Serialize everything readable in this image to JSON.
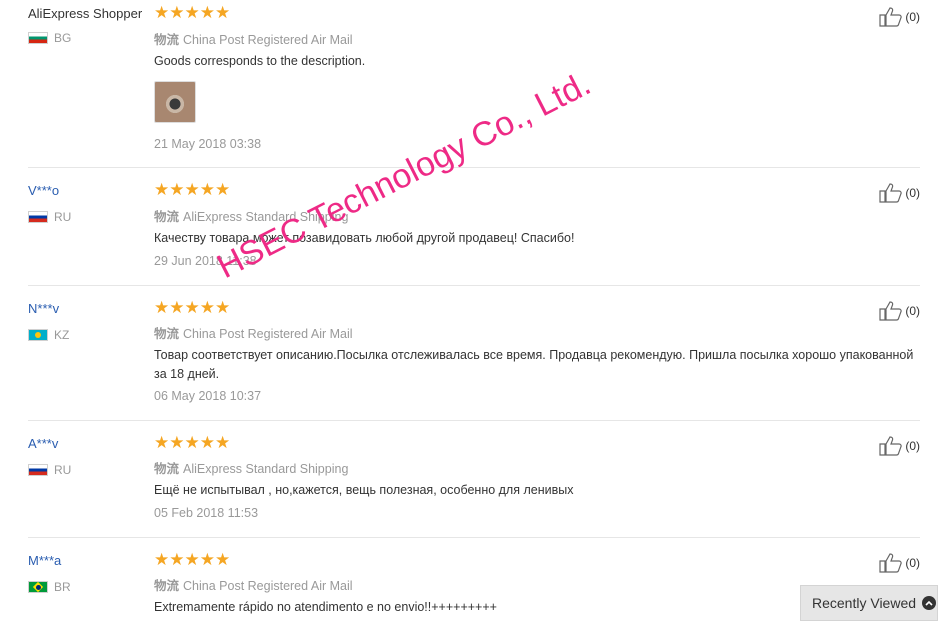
{
  "shipping_tag": "物流",
  "helpful_count": "(0)",
  "reviews": [
    {
      "user": "AliExpress Shopper",
      "country": "BG",
      "rating": 5,
      "stars": "★★★★★",
      "shipping": "China Post Registered Air Mail",
      "text": "Goods corresponds to the description.",
      "date": "21 May 2018 03:38",
      "has_photo": true
    },
    {
      "user": "V***o",
      "country": "RU",
      "rating": 5,
      "stars": "★★★★★",
      "shipping": "AliExpress Standard Shipping",
      "text": "Качеству товара может позавидовать любой другой продавец! Спасибо!",
      "date": "29 Jun 2018 11:38"
    },
    {
      "user": "N***v",
      "country": "KZ",
      "rating": 5,
      "stars": "★★★★★",
      "shipping": "China Post Registered Air Mail",
      "text": "Товар соответствует описанию.Посылка отслеживалась все время. Продавца рекомендую. Пришла посылка хорошо упакованной за 18 дней.",
      "date": "06 May 2018 10:37"
    },
    {
      "user": "A***v",
      "country": "RU",
      "rating": 5,
      "stars": "★★★★★",
      "shipping": "AliExpress Standard Shipping",
      "text": "Ещё не испытывал , но,кажется, вещь полезная, особенно для ленивых",
      "date": "05 Feb 2018 11:53"
    },
    {
      "user": "M***a",
      "country": "BR",
      "rating": 5,
      "stars": "★★★★★",
      "shipping": "China Post Registered Air Mail",
      "text": "Extremamente rápido no atendimento e no envio!!+++++++++",
      "date": ""
    }
  ],
  "watermark": "HSEC Technology Co., Ltd.",
  "recently_viewed": "Recently Viewed",
  "colors": {
    "star": "#f5a623",
    "link": "#2a5db0",
    "watermark": "#ee2a86"
  }
}
